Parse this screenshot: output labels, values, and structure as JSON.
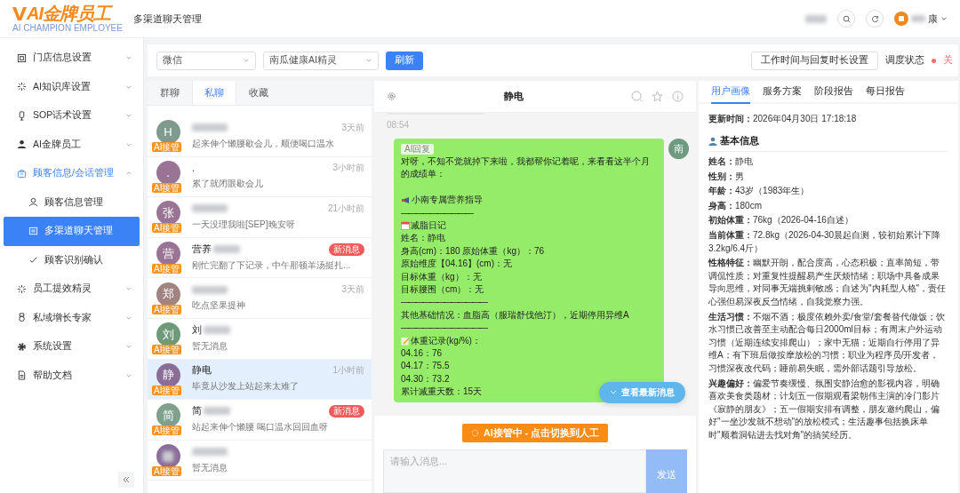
{
  "header": {
    "logo": "AI金牌员工",
    "logo_tagline": "AI CHAMPION EMPLOYEE",
    "page_title": "多渠道聊天管理",
    "user_name": "康"
  },
  "sidebar": {
    "items": [
      {
        "label": "门店信息设置",
        "expanded": false,
        "selected": false
      },
      {
        "label": "AI知识库设置",
        "expanded": false,
        "selected": false
      },
      {
        "label": "SOP话术设置",
        "expanded": false,
        "selected": false
      },
      {
        "label": "AI金牌员工",
        "expanded": false,
        "selected": false
      },
      {
        "label": "顾客信息/会话管理",
        "expanded": true,
        "selected": true,
        "children": [
          {
            "label": "顾客信息管理",
            "selected": false
          },
          {
            "label": "多渠道聊天管理",
            "selected": true
          },
          {
            "label": "顾客识别确认",
            "selected": false
          }
        ]
      },
      {
        "label": "员工提效精灵",
        "expanded": false,
        "selected": false
      },
      {
        "label": "私域增长专家",
        "expanded": false,
        "selected": false
      },
      {
        "label": "系统设置",
        "expanded": false,
        "selected": false
      },
      {
        "label": "帮助文档",
        "expanded": false,
        "selected": false
      }
    ]
  },
  "filters": {
    "channel": "微信",
    "bot": "南瓜健康AI精灵",
    "refresh": "刷新",
    "hours_button": "工作时间与回复时长设置",
    "dispatch_label": "调度状态",
    "dispatch_on": false,
    "dispatch_value": "关"
  },
  "conversation_tabs": [
    {
      "label": "群聊",
      "selected": false
    },
    {
      "label": "私聊",
      "selected": true
    },
    {
      "label": "收藏",
      "selected": false
    }
  ],
  "conversations": [
    {
      "avatar": "H",
      "color": "#7f9a8e",
      "redacted": true,
      "time": "3天前",
      "preview": "起来伸个懒腰歇会儿，顺便喝口温水",
      "badge": "AI接管",
      "selected": false
    },
    {
      "avatar": ".",
      "color": "#9a7494",
      "name": ".",
      "redacted": false,
      "time": "3小时前",
      "preview": "累了就闭眼歇会儿",
      "badge": "AI接管",
      "selected": false
    },
    {
      "avatar": "张",
      "color": "#9a7494",
      "redacted": true,
      "time": "21小时前",
      "preview": "一天没理我啦[SEP]晚安呀",
      "badge": "AI接管",
      "selected": false
    },
    {
      "avatar": "营",
      "color": "#9a7494",
      "name": "营养",
      "redacted": true,
      "new": "新消息",
      "preview": "刚忙完翻了下记录，中午那顿羊汤挺扎...",
      "badge": "AI接管",
      "selected": false
    },
    {
      "avatar": "郑",
      "color": "#a08482",
      "redacted": true,
      "time": "3天前",
      "preview": "吃点坚果提神",
      "badge": "AI接管",
      "selected": false
    },
    {
      "avatar": "刘",
      "color": "#6f9a7a",
      "name": "刘",
      "redacted": true,
      "preview": "暂无消息",
      "badge": "AI接管",
      "selected": false
    },
    {
      "avatar": "静",
      "color": "#8a6e98",
      "name": "静电",
      "redacted": false,
      "time": "1小时前",
      "preview": "毕竟从沙发上站起来太难了",
      "badge": "AI接管",
      "selected": true
    },
    {
      "avatar": "简",
      "color": "#7fa08a",
      "name": "简",
      "redacted": true,
      "new": "新消息",
      "preview": "站起来伸个懒腰 喝口温水回回血呀",
      "badge": "AI接管",
      "selected": false
    },
    {
      "color": "#8a6e98",
      "redacted": true,
      "preview": "暂无消息",
      "badge": "AI接管",
      "selected": false
    }
  ],
  "chat": {
    "title": "静电",
    "earlier_time": "08:54",
    "reply_avatar": "南",
    "reply_tag": "AI回复",
    "lines": [
      {
        "kind": "text",
        "text": "对呀，不知不觉就掉下来啦，我都帮你记着呢，来看看这半个月的成绩单："
      },
      {
        "kind": "blank"
      },
      {
        "kind": "megaphone",
        "text": "小南专属营养指导"
      },
      {
        "kind": "rule",
        "text": "——————————"
      },
      {
        "kind": "calendar",
        "text": "减脂日记"
      },
      {
        "kind": "text",
        "text": "姓名：静电"
      },
      {
        "kind": "text",
        "text": "身高(cm)：180 原始体重（kg）：76"
      },
      {
        "kind": "text",
        "text": "原始维度【04.16】(cm)：无"
      },
      {
        "kind": "text",
        "text": "目标体重（kg）：无"
      },
      {
        "kind": "text",
        "text": "目标腰围（cm）：无"
      },
      {
        "kind": "rule",
        "text": "————————————"
      },
      {
        "kind": "text",
        "text": "其他基础情况：血脂高（服瑞舒伐他汀），近期停用异维A"
      },
      {
        "kind": "rule",
        "text": "————————————"
      },
      {
        "kind": "memo",
        "text": "体重记录(kg/%)："
      },
      {
        "kind": "text",
        "text": "04.16：76"
      },
      {
        "kind": "text",
        "text": "04.17：75.5"
      },
      {
        "kind": "text",
        "text": "04.30：73.2"
      },
      {
        "kind": "text",
        "text": "累计减重天数：15天"
      }
    ],
    "latest_button": "查看最新消息",
    "takeover_button": "AI接管中 - 点击切换到人工",
    "input_placeholder": "请输入消息...",
    "send": "发送"
  },
  "profile": {
    "tabs": [
      {
        "label": "用户画像",
        "selected": true
      },
      {
        "label": "服务方案",
        "selected": false
      },
      {
        "label": "阶段报告",
        "selected": false
      },
      {
        "label": "每日报告",
        "selected": false
      }
    ],
    "updated": {
      "label": "更新时间：",
      "value": "2026年04月30日 17:18:18"
    },
    "section_title": "基本信息",
    "fields": [
      {
        "label": "姓名：",
        "value": "静电"
      },
      {
        "label": "性别：",
        "value": "男"
      },
      {
        "label": "年龄：",
        "value": "43岁（1983年生）"
      },
      {
        "label": "身高：",
        "value": "180cm"
      },
      {
        "label": "初始体重：",
        "value": "76kg（2026-04-16自述）"
      },
      {
        "label": "当前体重：",
        "value": "72.8kg（2026-04-30晨起自测，较初始累计下降3.2kg/6.4斤）"
      },
      {
        "label": "性格特征：",
        "value": "幽默开朗，配合度高，心态积极；直率简短，带调侃性质；对重复性提醒易产生厌烦情绪；职场中具备成果导向思维，对同事无端挑剌敏感；自述为\"内耗型人格\"，责任心强但易深夜反刍情绪，自我觉察力强。"
      },
      {
        "label": "生活习惯：",
        "value": "不烟不酒；极度依赖外卖/食堂/套餐替代做饭；饮水习惯已改善至主动配合每日2000ml目标；有周末户外运动习惯（近期连续安排爬山）；家中无猫；近期自行停用了异维A；有下班后做按摩放松的习惯；职业为程序员/开发者，习惯深夜改代码；睡前易失眠，需外部话题引导放松。"
      },
      {
        "label": "兴趣偏好：",
        "value": "偏爱节奏缓慢、氛围安静治愈的影视内容，明确喜欢美食类题材；计划五一假期观看梁朝伟主演的冷门影片《寂静的朋友》；五一假期安排有调整，朋友邀约爬山，偏好\"一坐沙发就不想动\"的放松模式；生活趣事包括换床单时\"顺着洞钻进去找对角\"的搞笑经历。"
      }
    ]
  }
}
